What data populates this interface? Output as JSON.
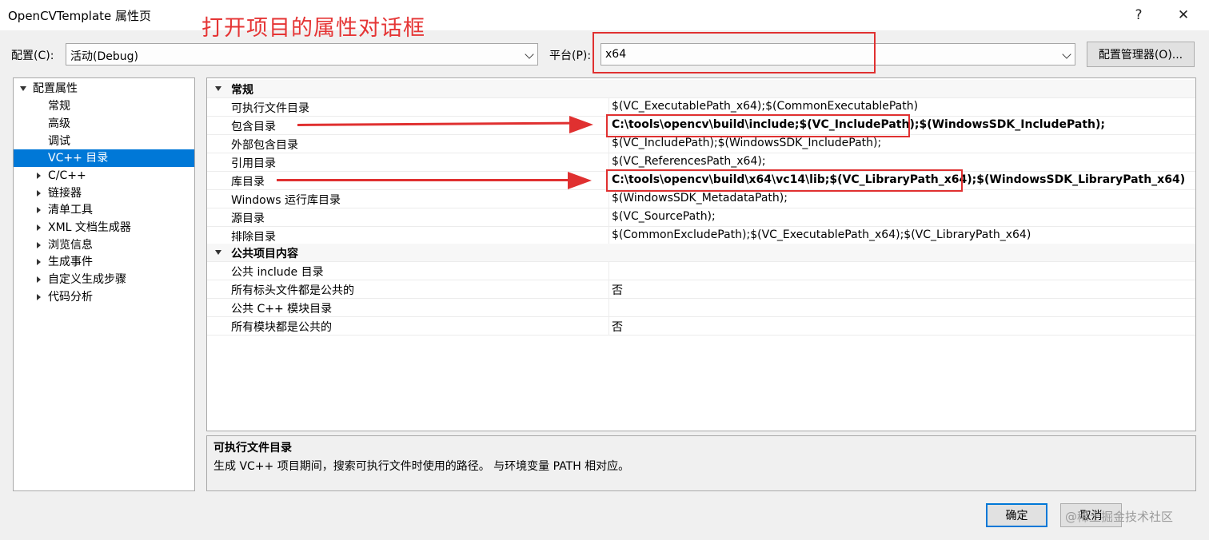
{
  "window": {
    "title": "OpenCVTemplate 属性页",
    "help": "?",
    "close": "✕"
  },
  "annotation": {
    "title": "打开项目的属性对话框"
  },
  "config": {
    "label": "配置(C):",
    "value": "活动(Debug)"
  },
  "platform": {
    "label": "平台(P):",
    "value": "x64"
  },
  "config_manager": {
    "label": "配置管理器(O)..."
  },
  "tree": [
    {
      "label": "配置属性",
      "state": "expanded",
      "level": 0
    },
    {
      "label": "常规",
      "level": 1
    },
    {
      "label": "高级",
      "level": 1
    },
    {
      "label": "调试",
      "level": 1
    },
    {
      "label": "VC++ 目录",
      "level": 1,
      "selected": true
    },
    {
      "label": "C/C++",
      "state": "collapsed",
      "level": 1
    },
    {
      "label": "链接器",
      "state": "collapsed",
      "level": 1
    },
    {
      "label": "清单工具",
      "state": "collapsed",
      "level": 1
    },
    {
      "label": "XML 文档生成器",
      "state": "collapsed",
      "level": 1
    },
    {
      "label": "浏览信息",
      "state": "collapsed",
      "level": 1
    },
    {
      "label": "生成事件",
      "state": "collapsed",
      "level": 1
    },
    {
      "label": "自定义生成步骤",
      "state": "collapsed",
      "level": 1
    },
    {
      "label": "代码分析",
      "state": "collapsed",
      "level": 1
    }
  ],
  "grid": {
    "categories": [
      {
        "name": "常规",
        "rows": [
          {
            "name": "可执行文件目录",
            "value": "$(VC_ExecutablePath_x64);$(CommonExecutablePath)"
          },
          {
            "name": "包含目录",
            "value": "C:\\tools\\opencv\\build\\include;$(VC_IncludePath);$(WindowsSDK_IncludePath);",
            "bold": true
          },
          {
            "name": "外部包含目录",
            "value": "$(VC_IncludePath);$(WindowsSDK_IncludePath);"
          },
          {
            "name": "引用目录",
            "value": "$(VC_ReferencesPath_x64);"
          },
          {
            "name": "库目录",
            "value": "C:\\tools\\opencv\\build\\x64\\vc14\\lib;$(VC_LibraryPath_x64);$(WindowsSDK_LibraryPath_x64)",
            "bold": true
          },
          {
            "name": "Windows 运行库目录",
            "value": "$(WindowsSDK_MetadataPath);"
          },
          {
            "name": "源目录",
            "value": "$(VC_SourcePath);"
          },
          {
            "name": "排除目录",
            "value": "$(CommonExcludePath);$(VC_ExecutablePath_x64);$(VC_LibraryPath_x64)"
          }
        ]
      },
      {
        "name": "公共项目内容",
        "rows": [
          {
            "name": "公共 include 目录",
            "value": ""
          },
          {
            "name": "所有标头文件都是公共的",
            "value": "否"
          },
          {
            "name": "公共 C++ 模块目录",
            "value": ""
          },
          {
            "name": "所有模块都是公共的",
            "value": "否"
          }
        ]
      }
    ]
  },
  "description": {
    "title": "可执行文件目录",
    "text": "生成 VC++ 项目期间，搜索可执行文件时使用的路径。 与环境变量 PATH 相对应。"
  },
  "buttons": {
    "ok": "确定",
    "cancel": "取消"
  },
  "watermark": "@稀土掘金技术社区",
  "colors": {
    "annotation_red": "#e03030",
    "selection_blue": "#0078d7"
  }
}
